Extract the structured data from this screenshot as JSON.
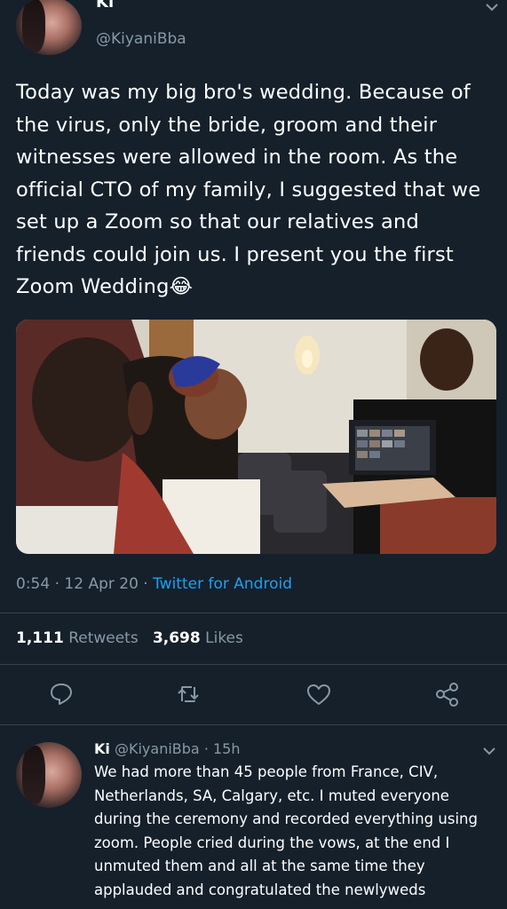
{
  "tweet": {
    "author_name": "Ki",
    "author_handle": "@KiyaniBba",
    "text": "Today was my big bro's wedding. Because of the virus, only the bride, groom and their witnesses were allowed in the room. As the official CTO of my family, I suggested that we set up a Zoom so that our relatives and friends could join us. I present you the first Zoom Wedding😂",
    "time": "0:54",
    "date": "12 Apr 20",
    "source": "Twitter for Android",
    "sep": "·",
    "retweets_count": "1,111",
    "retweets_label": "Retweets",
    "likes_count": "3,698",
    "likes_label": "Likes"
  },
  "reply": {
    "author_name": "Ki",
    "author_handle": "@KiyaniBba",
    "sep": "·",
    "age": "15h",
    "text": "We had more than 45 people from France, CIV, Netherlands, SA, Calgary, etc. I muted everyone during the ceremony and recorded everything using zoom. People cried during the vows, at the end I unmuted them and all at the same time they applauded and congratulated the newlyweds"
  },
  "icons": {
    "reply": "reply-icon",
    "retweet": "retweet-icon",
    "like": "like-icon",
    "share": "share-icon",
    "more": "chevron-down-icon"
  },
  "colors": {
    "background": "#15202b",
    "secondary_text": "#8899a6",
    "link": "#1da1f2",
    "divider": "#38444d"
  }
}
